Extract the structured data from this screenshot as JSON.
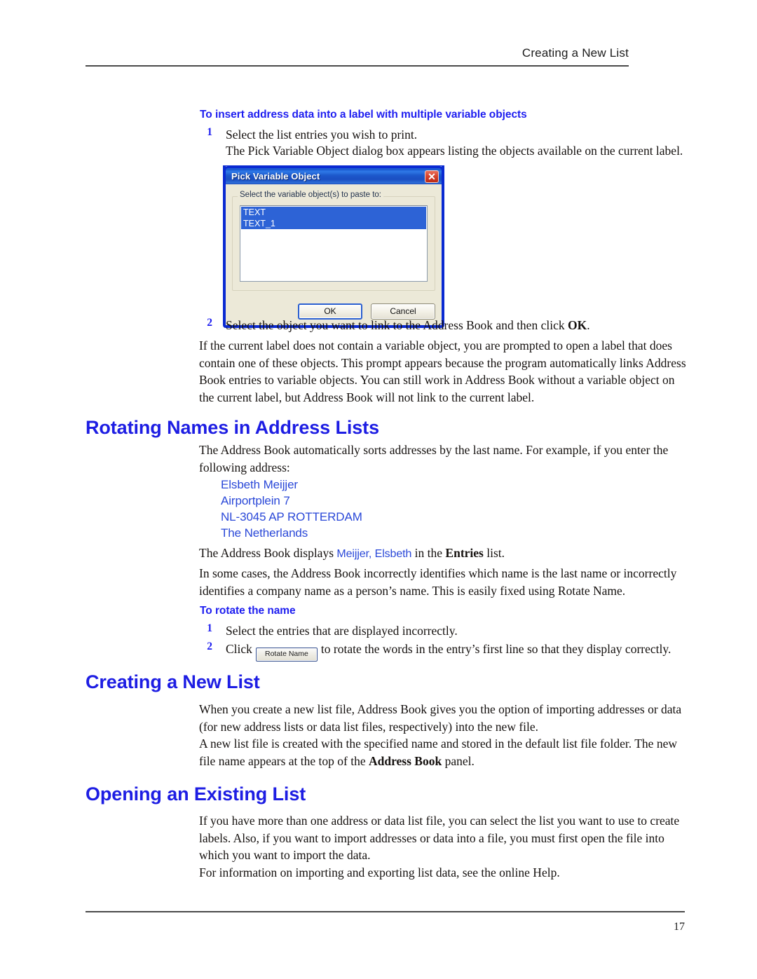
{
  "header": {
    "running_head": "Creating a New List"
  },
  "footer": {
    "page_number": "17"
  },
  "procedure1": {
    "heading": "To insert address data into a label with multiple variable objects",
    "step1_num": "1",
    "step1_text": "Select the list entries you wish to print.",
    "step1_note": "The Pick Variable Object dialog box appears listing the objects available on the current label.",
    "step2_num": "2",
    "step2_text_before": "Select the object you want to link to the Address Book and then click ",
    "step2_bold": "OK",
    "step2_text_after": ".",
    "after_paragraph": "If the current label does not contain a variable object, you are prompted to open a label that does contain one of these objects. This prompt appears because the program automatically links Address Book entries to variable objects. You can still work in Address Book without a variable object on the current label, but Address Book will not link to the current label."
  },
  "dialog": {
    "title": "Pick Variable Object",
    "close_label": "✕",
    "group_legend": "Select the variable object(s) to paste to:",
    "list_items": [
      {
        "label": "TEXT",
        "selected": true
      },
      {
        "label": "TEXT_1",
        "selected": true
      }
    ],
    "ok_label": "OK",
    "cancel_label": "Cancel"
  },
  "section_rotating": {
    "heading": "Rotating Names in Address Lists",
    "intro": "The Address Book automatically sorts addresses by the last name. For example, if you enter the following address:",
    "address_lines": [
      "Elsbeth Meijjer",
      "Airportplein 7",
      "NL-3045 AP ROTTERDAM",
      "The Netherlands"
    ],
    "displays_before": "The Address Book displays ",
    "displays_blue": "Meijjer, Elsbeth",
    "displays_middle": " in the ",
    "displays_bold": "Entries",
    "displays_after": " list.",
    "paragraph2": "In some cases, the Address Book incorrectly identifies which name is the last name or incorrectly identifies a company name as a person’s name. This is easily fixed using Rotate Name.",
    "procedure_heading": "To rotate the name",
    "step1_num": "1",
    "step1_text": "Select the entries that are displayed incorrectly.",
    "step2_num": "2",
    "step2_before": "Click",
    "step2_button": "Rotate Name",
    "step2_after": "to rotate the words in the entry’s first line so that they display correctly."
  },
  "section_creating": {
    "heading": "Creating a New List",
    "paragraph1": "When you create a new list file, Address Book gives you the option of importing addresses or data (for new address lists or data list files, respectively) into the new file.",
    "paragraph2_before": "A new list file is created with the specified name and stored in the default list file folder. The new file name appears at the top of the ",
    "paragraph2_bold": "Address Book",
    "paragraph2_after": " panel."
  },
  "section_opening": {
    "heading": "Opening an Existing List",
    "paragraph1": "If you have more than one address or data list file, you can select the list you want to use to create labels. Also, if you want to import addresses or data into a file, you must first open the file into which you want to import the data.",
    "paragraph2": "For information on importing and exporting list data, see the online Help."
  },
  "colors": {
    "heading_blue": "#1d1de3",
    "procedure_blue": "#1d1df0",
    "address_blue": "#2a48d8",
    "dialog_border": "#0a2ad2",
    "dialog_face": "#ece9d8",
    "selection_blue": "#2d63d6"
  }
}
